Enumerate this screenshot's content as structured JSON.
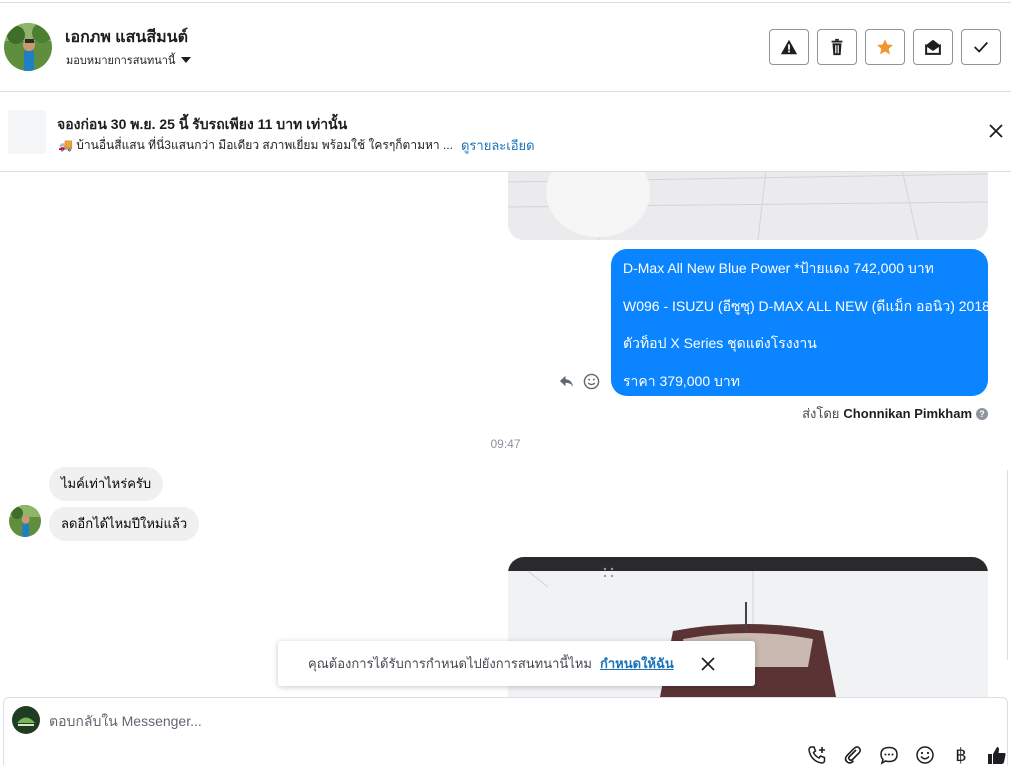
{
  "header": {
    "contact_name": "เอกภพ แสนสีมนต์",
    "assign_label": "มอบหมายการสนทนานี้",
    "actions": [
      "alert-icon",
      "trash-icon",
      "star-icon",
      "envelope-open-icon",
      "check-icon"
    ],
    "star_color": "#f0962e"
  },
  "ad": {
    "title": "จองก่อน 30 พ.ย. 25 นี้ รับรถเพียง 11 บาท เท่านั้น",
    "description": "🚚 บ้านอื่นสี่แสน ที่นี่3แสนกว่า มือเดียว สภาพเยี่ยม พร้อมใช้ ใครๆก็ตามหา ...",
    "link": "ดูรายละเอียด"
  },
  "messages": {
    "outgoing_lines": [
      "D-Max All New Blue Power *ป้ายแดง 742,000 บาท",
      "W096 - ISUZU (อีซูซุ) D-MAX ALL NEW (ดีแม็ก ออนิว) 2018",
      " ตัวท็อป X Series ชุดแต่งโรงงาน",
      "ราคา 379,000 บาท"
    ],
    "outgoing_color": "#0b84ff",
    "sent_by_prefix": "ส่งโดย",
    "sent_by_name": "Chonnikan Pimkham",
    "timestamp": "09:47",
    "incoming": [
      "ไมค์เท่าไหร่ครับ",
      "ลดอีกได้ไหมปีใหม่แล้ว"
    ]
  },
  "toast": {
    "text": "คุณต้องการได้รับการกำหนดไปยังการสนทนานี้ไหม",
    "link": "กำหนดให้ฉัน"
  },
  "composer": {
    "placeholder": "ตอบกลับใน Messenger...",
    "tools": [
      "phone-add-icon",
      "attachment-icon",
      "saved-reply-icon",
      "emoji-icon",
      "baht-icon",
      "thumbs-up-icon"
    ],
    "baht_symbol": "฿"
  }
}
